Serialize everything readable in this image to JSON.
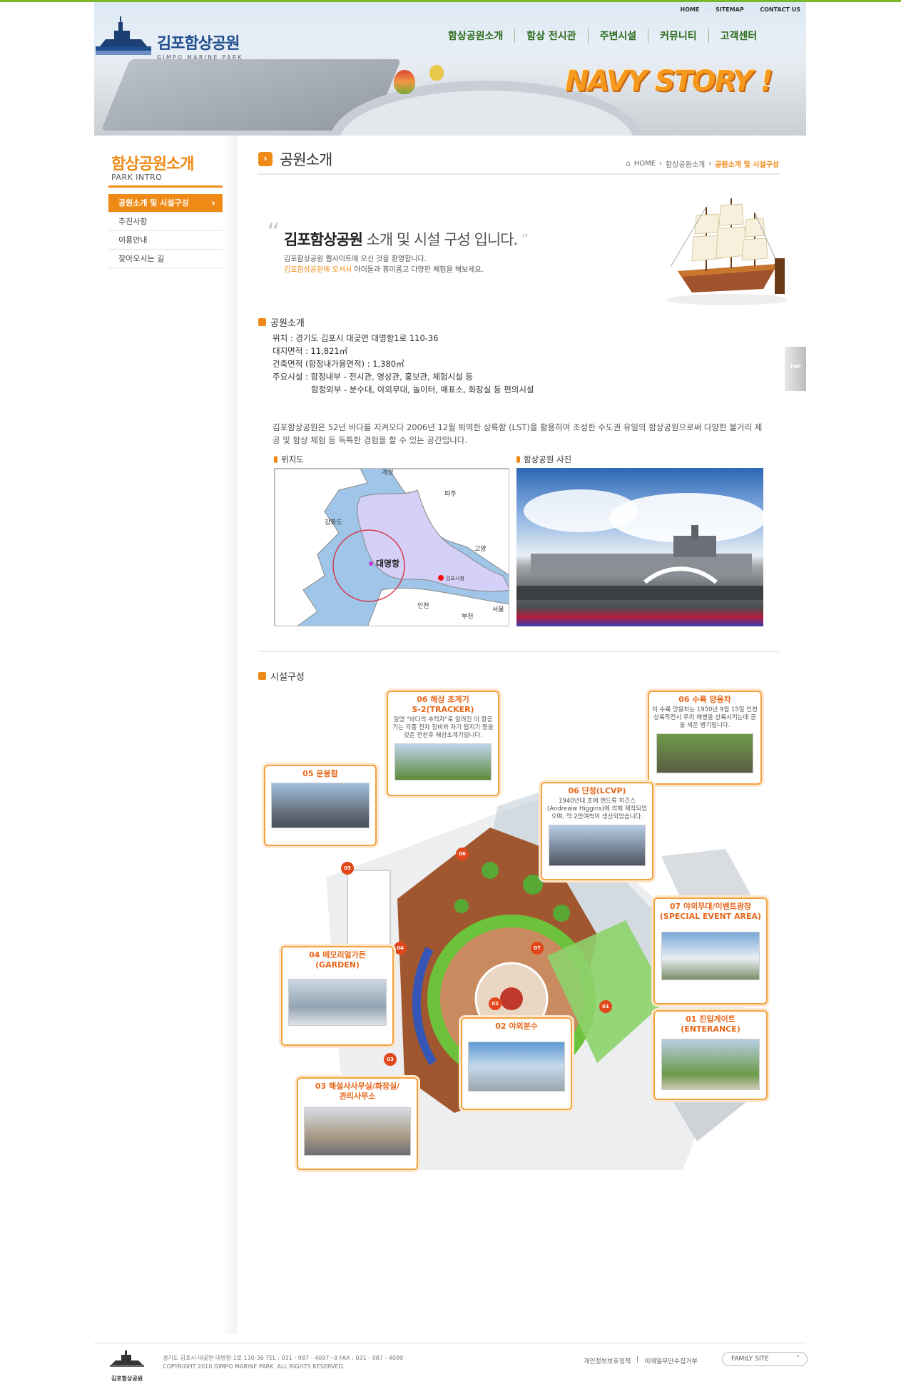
{
  "header": {
    "util_links": [
      "HOME",
      "SITEMAP",
      "CONTACT US"
    ],
    "logo_ko": "김포함상공원",
    "logo_en": "GIMPO MARINE PARK",
    "gnb": [
      "함상공원소개",
      "함상 전시관",
      "주변시설",
      "커뮤니티",
      "고객센터"
    ],
    "slogan": "NAVY STORY !"
  },
  "sidebar": {
    "title": "함상공원소개",
    "subtitle": "PARK INTRO",
    "items": [
      "공원소개 및 시설구성",
      "추진사항",
      "이용안내",
      "찾아오시는 길"
    ]
  },
  "page": {
    "title": "공원소개",
    "breadcrumb": [
      "HOME",
      "함상공원소개",
      "공원소개 및 시설구성"
    ]
  },
  "intro": {
    "headline_bold": "김포함상공원",
    "headline_rest": " 소개 및 시설 구성 입니다.",
    "line1": "김포함상공원 웹사이트에 오신 것을 환영합니다.",
    "line2_orange": "김포함상공원에 오셔서",
    "line2_rest": " 아이들과 흥미롭고 다양한 체험을 해보세요."
  },
  "park_info": {
    "section_title": "공원소개",
    "rows": [
      "위치 : 경기도 김포시 대곶면 대명항1로 110-36",
      "대지면적 : 11,821㎡",
      "건축면적 (함정내가용면적) : 1,380㎡",
      "주요시설 : 함정내부 - 전시관, 영상관, 홍보관, 체험시설 등",
      "함정외부 - 분수대, 야외무대, 놀이터, 매표소, 화장실 등 편의시설"
    ],
    "description": "김포함상공원은 52년 바다를 지켜오다 2006년 12월 퇴역한 상륙함 (LST)을 활용하여 조성한 수도권 유일의 함상공원으로써 다양한 볼거리 제공 및 함상 체험 등 독특한 경험을 할 수 있는 공간입니다."
  },
  "map": {
    "caption": "위치도",
    "labels": [
      "개성",
      "파주",
      "강화도",
      "고양",
      "대명항",
      "김포시청",
      "인천",
      "부천",
      "서울"
    ]
  },
  "photo": {
    "caption": "함상공원 사진"
  },
  "facilities": {
    "section_title": "시설구성",
    "cards": [
      {
        "title": "06 해상 초계기\nS-2(TRACKER)",
        "desc": "일명 \"바다의 추적자\"로 알려진 이 항공기는 각종 전자 장비와 자기 탐지기 등을 갖춘 전천후 해상초계기입니다."
      },
      {
        "title": "06 수륙 양용차",
        "desc": "이 수륙 양용차는 1950년 9월 15일 인천 상륙작전시 우리 해병을 상륙시키는데 공을 세운 병기입니다."
      },
      {
        "title": "05 운봉함",
        "desc": ""
      },
      {
        "title": "06 단정(LCVP)",
        "desc": "1940년대 초에 엔드류 히긴스 (Andreww Higgins)에 의해 제작되었으며, 약 2만여척이 생산되었습니다."
      },
      {
        "title": "07 야외무대/이벤트광장\n(SPECIAL EVENT AREA)",
        "desc": ""
      },
      {
        "title": "04 메모리얼가든\n(GARDEN)",
        "desc": ""
      },
      {
        "title": "02 야외분수",
        "desc": ""
      },
      {
        "title": "01 진입게이트\n(ENTERANCE)",
        "desc": ""
      },
      {
        "title": "03 해설사사무실/화장실/\n관리사무소",
        "desc": ""
      }
    ],
    "markers": [
      "06",
      "05",
      "07",
      "04",
      "02",
      "01",
      "03"
    ]
  },
  "top_button": "TOP",
  "footer": {
    "logo_text": "김포함상공원",
    "address": "경기도 김포시 대곶면 대명항 1로 110-36  TEL : 031 - 987 - 4097~8    FAX : 031 - 987 - 4099",
    "copyright": "COPYRIGHT 2010 GIMPO MARINE PARK.  ALL RIGHTS RESERVED.",
    "links": [
      "개인정보보호정책",
      "이메일무단수집거부"
    ],
    "family_site": "FAMILY SITE"
  },
  "colors": {
    "accent": "#f08a16",
    "gnb_green": "#2d6b1c",
    "logo_blue": "#1f4d8d",
    "topbar": "#7ab82a"
  }
}
